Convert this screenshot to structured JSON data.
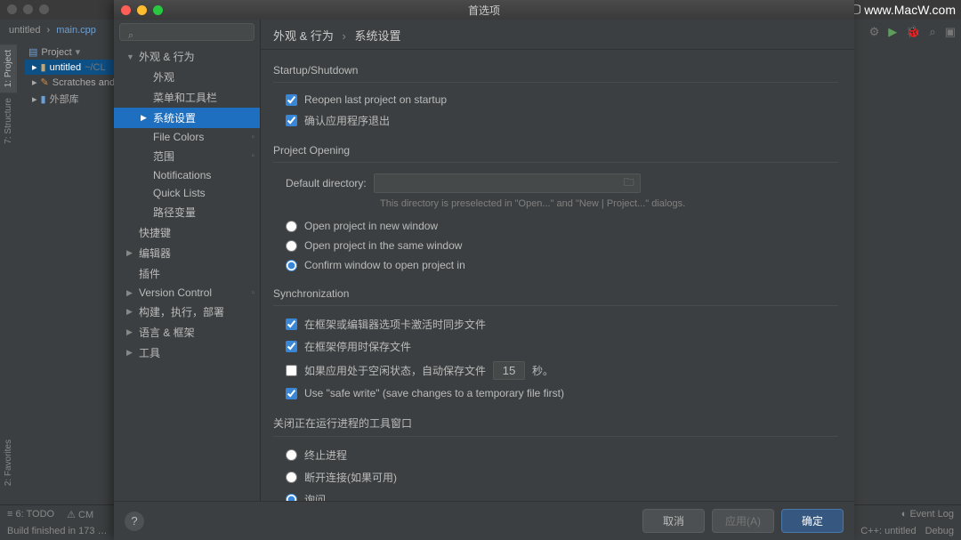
{
  "watermark": "www.MacW.com",
  "ide": {
    "breadcrumb1": "untitled",
    "breadcrumb2": "main.cpp",
    "project_label": "Project",
    "project_name": "untitled",
    "project_path": "~/CL",
    "scratches": "Scratches and",
    "external": "外部库",
    "sidetabs": {
      "project": "1: Project",
      "structure": "7: Structure",
      "favorites": "2: Favorites"
    },
    "status": {
      "todo": "6: TODO",
      "cmake": "CM",
      "build": "Build finished in 173 …",
      "eventlog": "Event Log",
      "encoding": "C++: untitled",
      "debug": "Debug"
    }
  },
  "dialog": {
    "title": "首选项",
    "search_placeholder": "",
    "tree": {
      "appearance_behavior": "外观 & 行为",
      "appearance": "外观",
      "menus_toolbars": "菜单和工具栏",
      "system_settings": "系统设置",
      "file_colors": "File Colors",
      "scopes": "范围",
      "notifications": "Notifications",
      "quick_lists": "Quick Lists",
      "path_vars": "路径变量",
      "keymap": "快捷键",
      "editor": "编辑器",
      "plugins": "插件",
      "vcs": "Version Control",
      "build": "构建，执行，部署",
      "lang_fw": "语言 & 框架",
      "tools": "工具"
    },
    "crumb1": "外观 & 行为",
    "crumb2": "系统设置",
    "sections": {
      "startup": "Startup/Shutdown",
      "reopen": "Reopen last project on startup",
      "confirm_exit": "确认应用程序退出",
      "project_opening": "Project Opening",
      "default_dir": "Default directory:",
      "dir_hint": "This directory is preselected in \"Open...\" and \"New | Project...\" dialogs.",
      "open_new": "Open project in new window",
      "open_same": "Open project in the same window",
      "open_confirm": "Confirm window to open project in",
      "sync": "Synchronization",
      "sync_on_activate": "在框架或编辑器选项卡激活时同步文件",
      "save_on_deactivate": "在框架停用时保存文件",
      "autosave_idle": "如果应用处于空闲状态，自动保存文件",
      "autosave_value": "15",
      "autosave_suffix": "秒。",
      "safe_write": "Use \"safe write\" (save changes to a temporary file first)",
      "close_tool": "关闭正在运行进程的工具窗口",
      "terminate": "终止进程",
      "disconnect": "断开连接(如果可用)",
      "ask": "询问"
    },
    "buttons": {
      "cancel": "取消",
      "apply": "应用(A)",
      "ok": "确定"
    }
  }
}
